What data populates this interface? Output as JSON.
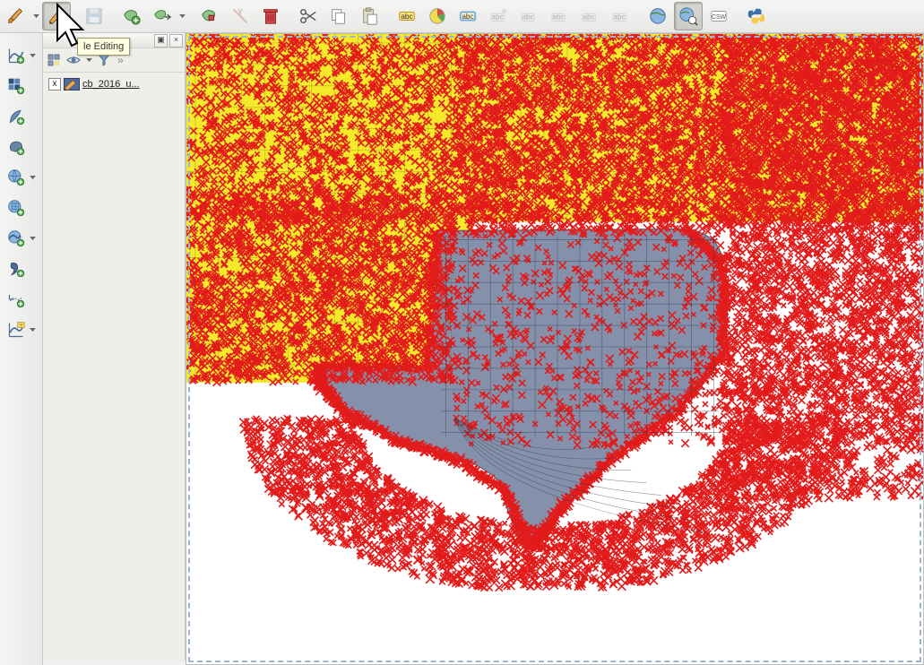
{
  "tooltip": "le Editing",
  "toolbar_top": {
    "current_edits": "Current Edits",
    "toggle_editing": "Toggle Editing",
    "save_edits": "Save Layer Edits",
    "add_feature": "Add Feature",
    "move_feature": "Move Feature",
    "node_tool": "Node Tool",
    "delete_selected": "Delete Selected",
    "cut": "Cut Features",
    "copy": "Copy Features",
    "paste": "Paste Features",
    "label_single": "abc",
    "diagram": "Diagram",
    "label_highlight": "abc",
    "label_pin": "abc",
    "label_unpin": "abc",
    "label_hide": "abc",
    "label_move": "abc",
    "label_rotate": "abc",
    "metasearch": "MetaSearch",
    "csw": "CSW",
    "python": "Python Console"
  },
  "left_toolbar": {
    "add_vector": "Add Vector Layer",
    "add_raster": "Add Raster Layer",
    "add_spatialite": "Add SpatiaLite Layer",
    "add_postgis": "Add PostGIS Layer",
    "add_wms": "Add WMS/WMTS Layer",
    "add_wcs": "Add WCS Layer",
    "add_wfs": "Add WFS Layer",
    "add_csv": "Add Delimited Text Layer",
    "add_virtual": "Add Virtual Layer",
    "new_shapefile": "New Shapefile Layer"
  },
  "layers_panel": {
    "layer_name": "cb_2016_u...",
    "checked": "x"
  },
  "map": {
    "layer_fill_a": "#f4ea2a",
    "layer_fill_b": "#8590ab",
    "edit_marker_color": "#e21b1b",
    "layer_name": "cb_2016_u..."
  }
}
